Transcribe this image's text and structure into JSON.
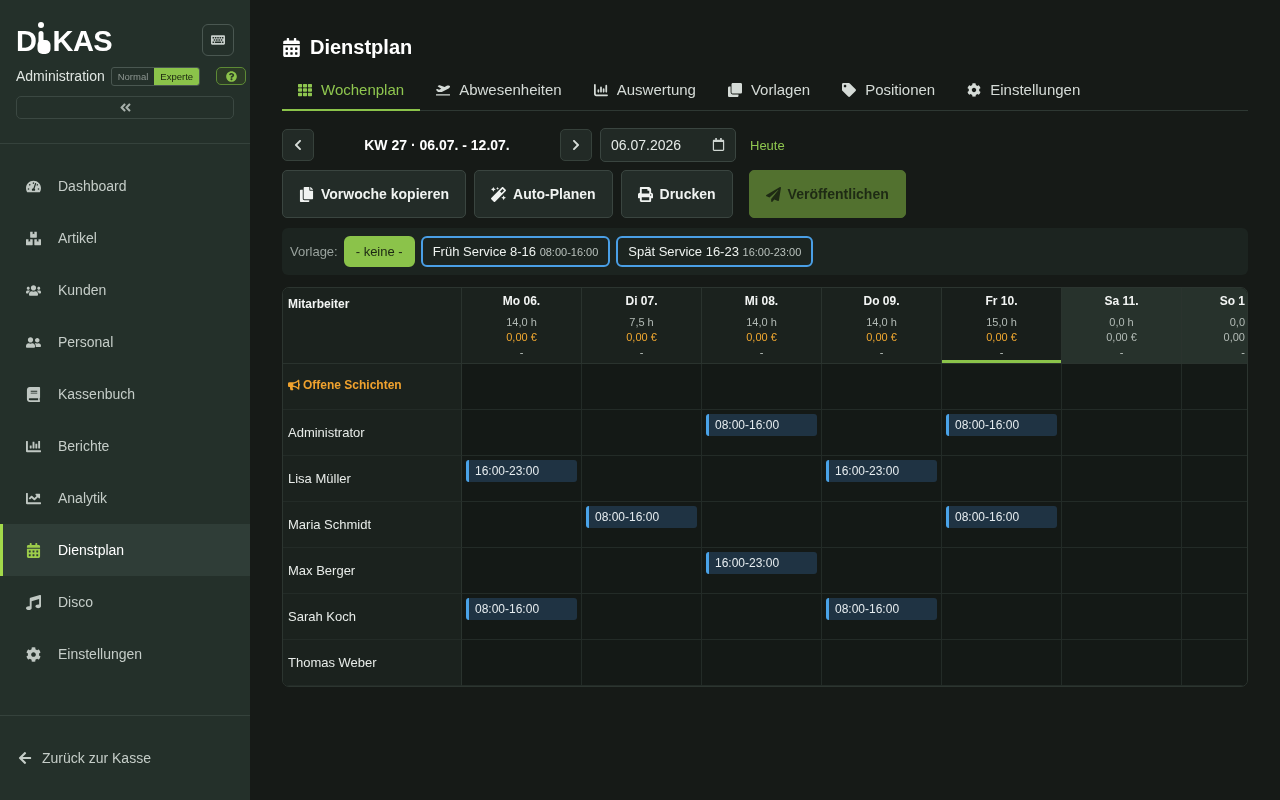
{
  "sidebar": {
    "logo": {
      "before": "D",
      "after": "KAS"
    },
    "role": "Administration",
    "modes": [
      {
        "label": "Normal",
        "selected": false
      },
      {
        "label": "Experte",
        "selected": true
      }
    ],
    "nav": [
      {
        "label": "Dashboard",
        "selected": false
      },
      {
        "label": "Artikel",
        "selected": false
      },
      {
        "label": "Kunden",
        "selected": false
      },
      {
        "label": "Personal",
        "selected": false
      },
      {
        "label": "Kassenbuch",
        "selected": false
      },
      {
        "label": "Berichte",
        "selected": false
      },
      {
        "label": "Analytik",
        "selected": false
      },
      {
        "label": "Dienstplan",
        "selected": true
      },
      {
        "label": "Disco",
        "selected": false
      },
      {
        "label": "Einstellungen",
        "selected": false
      }
    ],
    "back_link": "Zurück zur Kasse"
  },
  "header": {
    "title": "Dienstplan"
  },
  "tabs": [
    {
      "label": "Wochenplan",
      "selected": true
    },
    {
      "label": "Abwesenheiten",
      "selected": false
    },
    {
      "label": "Auswertung",
      "selected": false
    },
    {
      "label": "Vorlagen",
      "selected": false
    },
    {
      "label": "Positionen",
      "selected": false
    },
    {
      "label": "Einstellungen",
      "selected": false
    }
  ],
  "week_nav": {
    "label": "KW 27 · 06.07. - 12.07.",
    "date": "06.07.2026",
    "today_link": "Heute"
  },
  "actions": [
    {
      "label": "Vorwoche kopieren",
      "kind": "secondary"
    },
    {
      "label": "Auto-Planen",
      "kind": "secondary"
    },
    {
      "label": "Drucken",
      "kind": "secondary"
    },
    {
      "label": "Veröffentlichen",
      "kind": "primary"
    }
  ],
  "templates": {
    "label": "Vorlage:",
    "items": [
      {
        "label": "- keine -",
        "selected": true
      },
      {
        "label": "Früh Service 8-16",
        "time": "08:00-16:00",
        "selected": false
      },
      {
        "label": "Spät Service 16-23",
        "time": "16:00-23:00",
        "selected": false
      }
    ]
  },
  "schedule": {
    "corner": "Mitarbeiter",
    "days": [
      {
        "label": "Mo 06.",
        "hours": "14,0 h",
        "cost": "0,00 €",
        "note": "-",
        "today": false,
        "weekend": false
      },
      {
        "label": "Di 07.",
        "hours": "7,5 h",
        "cost": "0,00 €",
        "note": "-",
        "today": false,
        "weekend": false
      },
      {
        "label": "Mi 08.",
        "hours": "14,0 h",
        "cost": "0,00 €",
        "note": "-",
        "today": false,
        "weekend": false
      },
      {
        "label": "Do 09.",
        "hours": "14,0 h",
        "cost": "0,00 €",
        "note": "-",
        "today": false,
        "weekend": false
      },
      {
        "label": "Fr 10.",
        "hours": "15,0 h",
        "cost": "0,00 €",
        "note": "-",
        "today": true,
        "weekend": false
      },
      {
        "label": "Sa 11.",
        "hours": "0,0 h",
        "cost": "0,00 €",
        "note": "-",
        "today": false,
        "weekend": true
      },
      {
        "label": "So 1",
        "hours": "0,0",
        "cost": "0,00",
        "note": "-",
        "today": false,
        "weekend": true
      }
    ],
    "open_shifts": {
      "label": "Offene Schichten"
    },
    "rows": [
      {
        "name": "Administrator",
        "cells": [
          null,
          null,
          {
            "time": "08:00-16:00"
          },
          null,
          {
            "time": "08:00-16:00"
          },
          null,
          null
        ]
      },
      {
        "name": "Lisa Müller",
        "cells": [
          {
            "time": "16:00-23:00"
          },
          null,
          null,
          {
            "time": "16:00-23:00"
          },
          null,
          null,
          null
        ]
      },
      {
        "name": "Maria Schmidt",
        "cells": [
          null,
          {
            "time": "08:00-16:00"
          },
          null,
          null,
          {
            "time": "08:00-16:00"
          },
          null,
          null
        ]
      },
      {
        "name": "Max Berger",
        "cells": [
          null,
          null,
          {
            "time": "16:00-23:00"
          },
          null,
          null,
          null,
          null
        ]
      },
      {
        "name": "Sarah Koch",
        "cells": [
          {
            "time": "08:00-16:00"
          },
          null,
          null,
          {
            "time": "08:00-16:00"
          },
          null,
          null,
          null
        ]
      },
      {
        "name": "Thomas Weber",
        "cells": [
          null,
          null,
          null,
          null,
          null,
          null,
          null
        ]
      }
    ]
  }
}
